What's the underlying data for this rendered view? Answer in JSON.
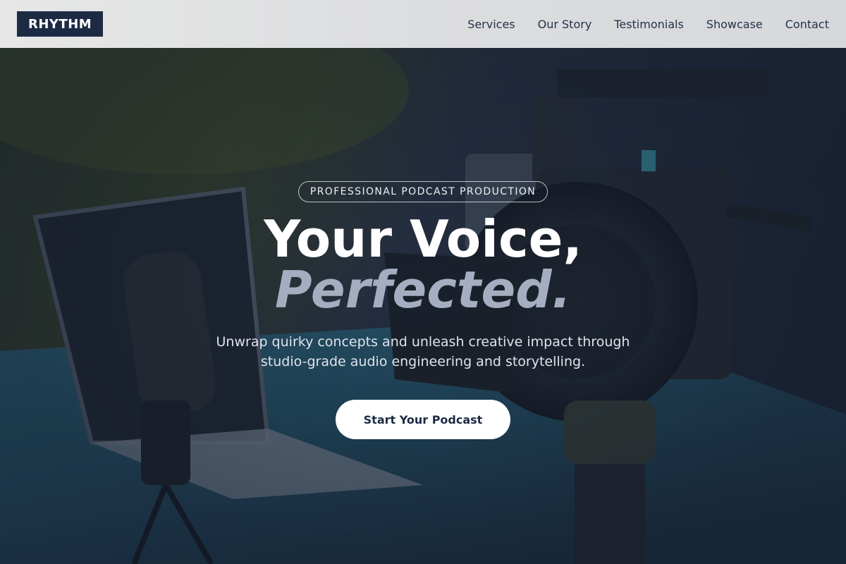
{
  "header": {
    "logo": "RHYTHM",
    "nav": [
      "Services",
      "Our Story",
      "Testimonials",
      "Showcase",
      "Contact"
    ]
  },
  "hero": {
    "badge": "PROFESSIONAL PODCAST PRODUCTION",
    "title_line1": "Your Voice,",
    "title_line2": "Perfected.",
    "subtitle_line1": "Unwrap quirky concepts and unleash creative impact through",
    "subtitle_line2": "studio-grade audio engineering and storytelling.",
    "cta_label": "Start Your Podcast"
  },
  "colors": {
    "logo_bg": "#1c2b43",
    "accent_title": "#a5adc0",
    "cta_bg": "#ffffff",
    "cta_text": "#1c2b43"
  }
}
